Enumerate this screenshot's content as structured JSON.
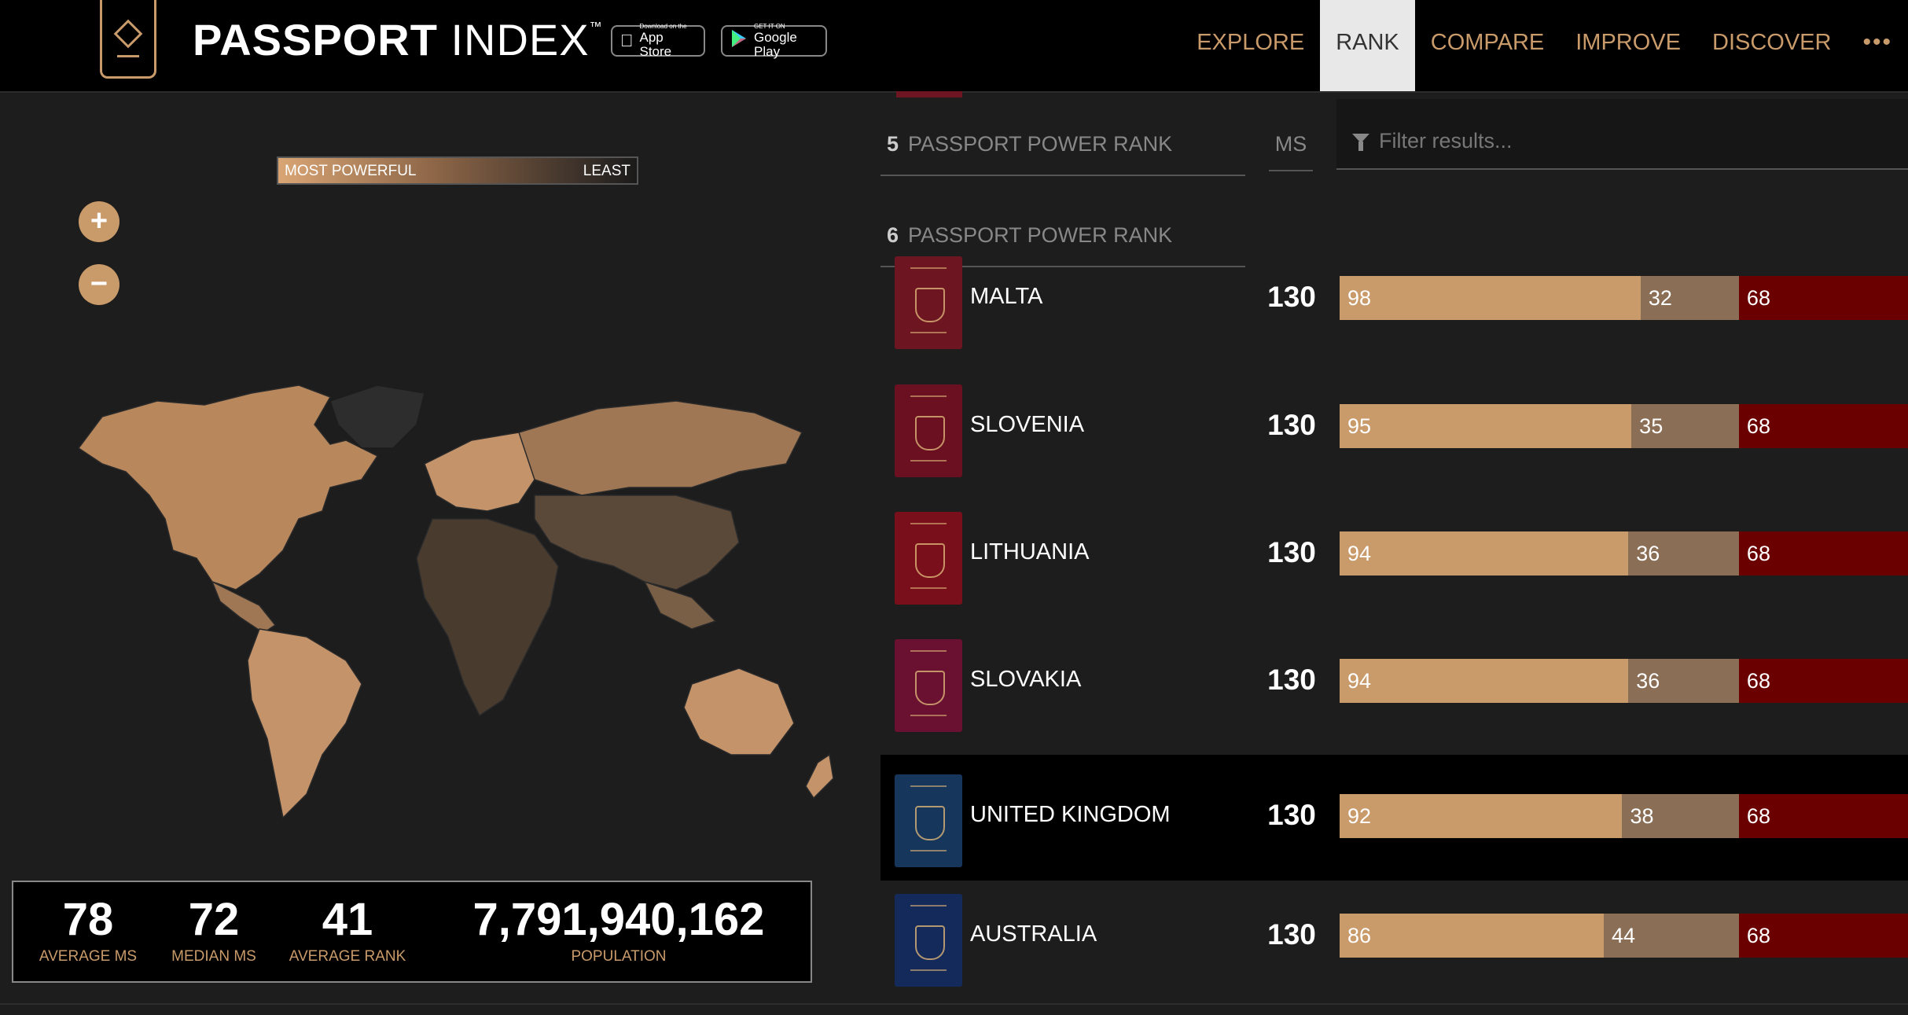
{
  "brand": {
    "name_bold": "PASSPORT",
    "name_light": "INDEX",
    "tm": "™"
  },
  "stores": [
    {
      "small": "Download on the",
      "big": "App Store",
      "icon": "apple-icon"
    },
    {
      "small": "GET IT ON",
      "big": "Google Play",
      "icon": "play-icon"
    }
  ],
  "nav": {
    "items": [
      "EXPLORE",
      "RANK",
      "COMPARE",
      "IMPROVE",
      "DISCOVER"
    ],
    "active": "RANK",
    "more": "•••"
  },
  "legend": {
    "left": "MOST POWERFUL",
    "right": "LEAST"
  },
  "zoom": {
    "in": "+",
    "out": "−"
  },
  "stats": [
    {
      "value": "78",
      "label": "AVERAGE MS"
    },
    {
      "value": "72",
      "label": "MEDIAN MS"
    },
    {
      "value": "41",
      "label": "AVERAGE RANK"
    },
    {
      "value": "7,791,940,162",
      "label": "POPULATION"
    }
  ],
  "rank_headers": [
    {
      "num": "5",
      "label": "PASSPORT POWER RANK"
    },
    {
      "num": "6",
      "label": "PASSPORT POWER RANK"
    }
  ],
  "ms_header": "MS",
  "filter": {
    "placeholder": "Filter results..."
  },
  "colors": {
    "accent": "#c99a6a",
    "visa_on_arrival": "#8a6e55",
    "visa_required": "#6b0000"
  },
  "rows": [
    {
      "country": "MALTA",
      "score": "130",
      "visa_free": 98,
      "visa_on_arrival": 32,
      "visa_required": 68,
      "passport_color": "#6e1522",
      "highlight": false
    },
    {
      "country": "SLOVENIA",
      "score": "130",
      "visa_free": 95,
      "visa_on_arrival": 35,
      "visa_required": 68,
      "passport_color": "#6a1020",
      "highlight": false
    },
    {
      "country": "LITHUANIA",
      "score": "130",
      "visa_free": 94,
      "visa_on_arrival": 36,
      "visa_required": 68,
      "passport_color": "#7a0f1c",
      "highlight": false
    },
    {
      "country": "SLOVAKIA",
      "score": "130",
      "visa_free": 94,
      "visa_on_arrival": 36,
      "visa_required": 68,
      "passport_color": "#6a1030",
      "highlight": false
    },
    {
      "country": "UNITED KINGDOM",
      "score": "130",
      "visa_free": 92,
      "visa_on_arrival": 38,
      "visa_required": 68,
      "passport_color": "#17365c",
      "highlight": true
    },
    {
      "country": "AUSTRALIA",
      "score": "130",
      "visa_free": 86,
      "visa_on_arrival": 44,
      "visa_required": 68,
      "passport_color": "#142a5a",
      "highlight": false
    }
  ]
}
